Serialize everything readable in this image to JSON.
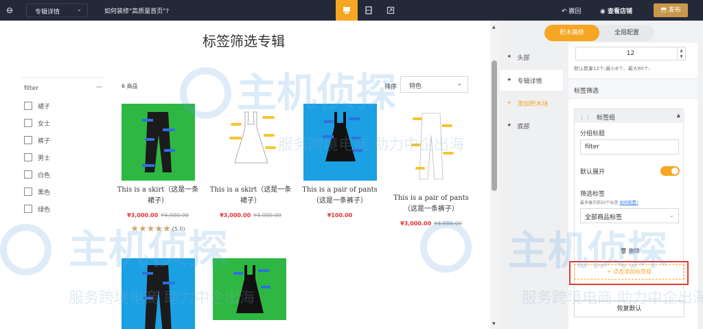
{
  "topbar": {
    "page_select": "专辑详情",
    "help_text": "如何装修\"高质量首页\"?",
    "undo": "撤回",
    "view_store": "查看店铺",
    "publish": "发布"
  },
  "canvas": {
    "page_title": "标签筛选专辑",
    "filter_head": "filter",
    "filters": [
      "裙子",
      "女士",
      "裤子",
      "男士",
      "白色",
      "黑色",
      "绿色"
    ],
    "count_label": "6 商品",
    "sort_label": "排序",
    "sort_value": "特色",
    "products": [
      {
        "title": "This is a skirt（这是一条裙子）",
        "price": "¥3,000.00",
        "old": "¥4,000.00",
        "image_color": "#2eb843",
        "stars": "★★★★★",
        "score": "(5.0)"
      },
      {
        "title": "This is a skirt（这是一条裙子）",
        "price": "¥3,000.00",
        "old": "¥4,000.00",
        "image_color": "#ffffff"
      },
      {
        "title": "This is a pair of pants（这是一条裤子）",
        "price": "¥100.00",
        "image_color": "#1aa0e3"
      },
      {
        "title": "This is a pair of pants（这是一条裤子）",
        "price": "¥3,000.00",
        "old": "¥4,000.00",
        "image_color": "#ffffff"
      }
    ]
  },
  "module_tabs": {
    "head": "头部",
    "detail": "专辑详情",
    "add": "添加积木块",
    "footer": "底部"
  },
  "settings": {
    "mode_blocks": "积木装修",
    "mode_global": "全局配置",
    "number_value": "12",
    "number_hint": "默认数量12个;最小8个、最大80个;",
    "section_title": "标签筛选",
    "group_title": "标签组",
    "group_title_label": "分组标题",
    "group_title_value": "filter",
    "default_expand_label": "默认展开",
    "filter_tags_label": "筛选标签",
    "filter_tags_hint": "最多展示前50个标签",
    "filter_tags_link": "如何配置?",
    "tag_select_value": "全部商品标签",
    "delete_label": "删除",
    "add_tag_label": "+ 点击添加标签组",
    "reset_label": "恢复默认",
    "accent_color": "#f5a623",
    "highlight_color": "#e53935"
  },
  "watermark": {
    "brand": "主机侦探",
    "slogan": "服务跨境电商 助力中企出海"
  }
}
